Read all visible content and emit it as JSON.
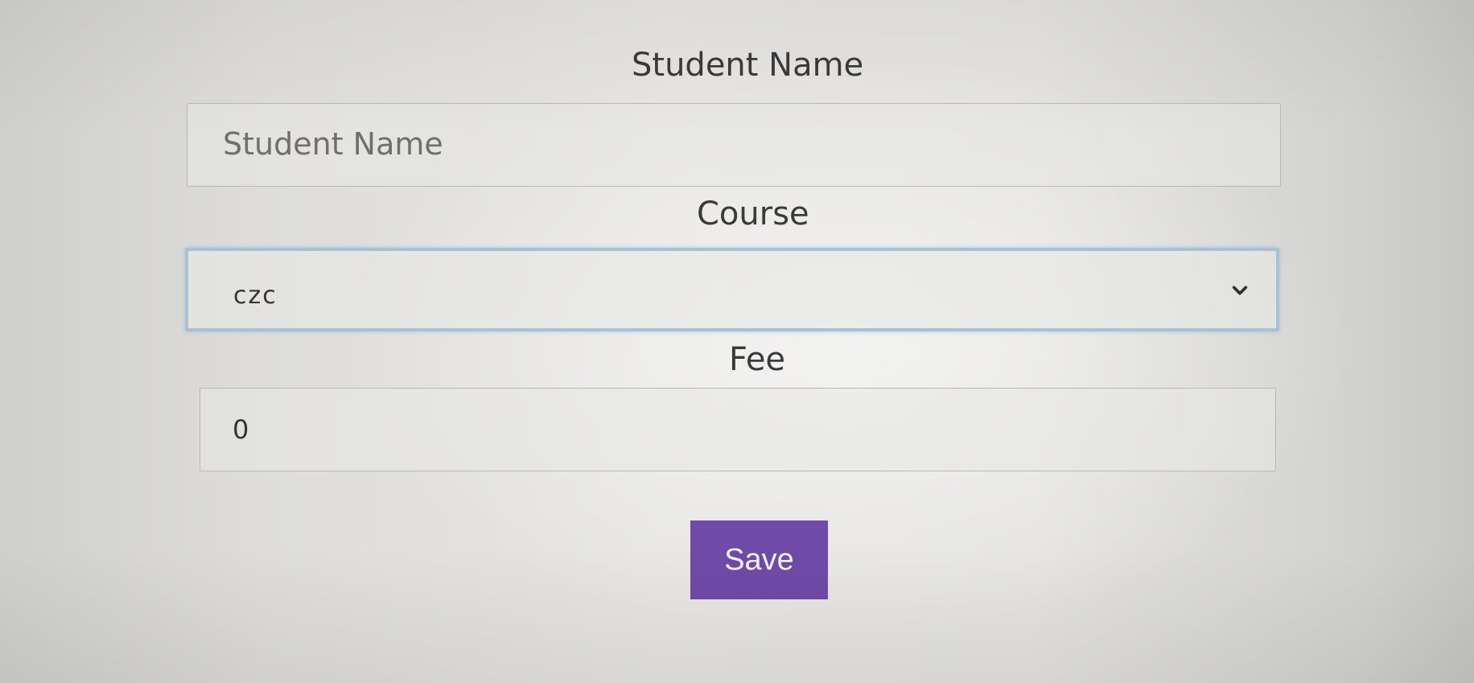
{
  "form": {
    "student_name_label": "Student Name",
    "student_name_placeholder": "Student Name",
    "course_label": "Course",
    "course_selected": "czc",
    "fee_label": "Fee",
    "fee_value": "0",
    "save_label": "Save"
  },
  "icons": {
    "course_dropdown": "chevron-down-icon"
  },
  "colors": {
    "save_button_bg": "#6f4aa7",
    "focus_border": "#a9c1d6"
  }
}
